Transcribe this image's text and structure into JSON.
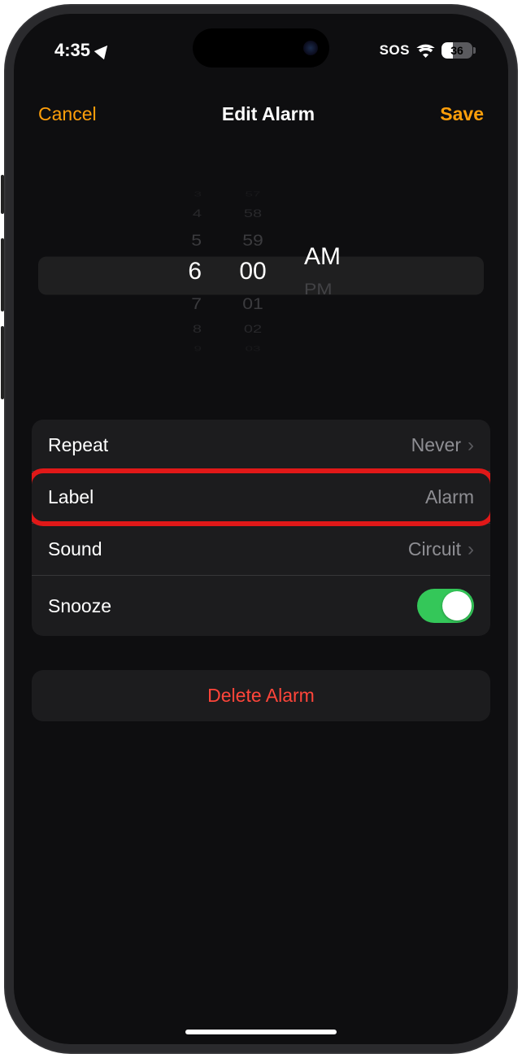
{
  "status": {
    "time": "4:35",
    "sos": "SOS",
    "battery_pct": 36,
    "battery_text": "36"
  },
  "nav": {
    "cancel": "Cancel",
    "title": "Edit Alarm",
    "save": "Save"
  },
  "picker": {
    "hours": [
      "3",
      "4",
      "5",
      "6",
      "7",
      "8",
      "9"
    ],
    "minutes": [
      "57",
      "58",
      "59",
      "00",
      "01",
      "02",
      "03"
    ],
    "ampm": [
      "AM",
      "PM"
    ],
    "selected_hour": "6",
    "selected_minute": "00",
    "selected_ampm": "AM"
  },
  "settings": {
    "repeat": {
      "label": "Repeat",
      "value": "Never"
    },
    "label": {
      "label": "Label",
      "value": "Alarm"
    },
    "sound": {
      "label": "Sound",
      "value": "Circuit"
    },
    "snooze": {
      "label": "Snooze",
      "on": true
    }
  },
  "delete": {
    "label": "Delete Alarm"
  }
}
